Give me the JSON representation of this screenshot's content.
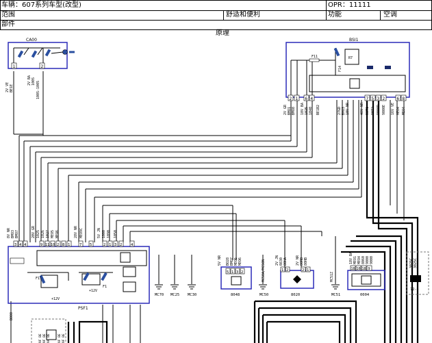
{
  "header": {
    "vehicle": "车辆：607系列车型(改型)",
    "opr": "OPR：11111",
    "scope_label": "范围",
    "scope_value": "舒适和便利",
    "function_label": "功能",
    "function_value": "空调",
    "parts_label": "部件"
  },
  "diagram": {
    "section_title": "原理",
    "components": {
      "ca00": {
        "label": "CA00",
        "pins": [
          "1",
          "2"
        ],
        "wires_1": [
          "2V VE",
          "BE1E"
        ],
        "wires_2": [
          "2V BA",
          "100S",
          "100S",
          "100S-1005"
        ]
      },
      "bsi1": {
        "label": "BSI1",
        "fuse_label": "F11",
        "relay_label": "R7",
        "fuse2_label": "F14",
        "pins_left": [
          "2",
          "1",
          "6",
          "4"
        ],
        "pins_right": [
          "7",
          "8",
          "5",
          "3",
          "2",
          "6",
          "8"
        ],
        "wires": [
          "2V GR",
          "BMO1",
          "BMO8",
          "10V BA",
          "1025",
          "1040",
          "BE1B2",
          "27GD",
          "BMO3",
          "10V NR",
          "40V NR",
          "90T1",
          "90T2",
          "9000D",
          "9000E",
          "16V VE",
          "MEO4",
          "MEO4"
        ]
      },
      "psf1": {
        "label": "PSF1",
        "pins": [
          "3",
          "4",
          "9",
          "11",
          "10",
          "2",
          "8",
          "1",
          "6",
          "7",
          "5",
          "2",
          "1",
          "3",
          "2",
          "4"
        ],
        "wires": [
          "8V NR",
          "BMO3",
          "BMO7",
          "20V GR",
          "1025",
          "1026",
          "1027",
          "MEO5",
          "MEO6",
          "28V NR",
          "MEO9C",
          "5V JN",
          "1000",
          "1090",
          "1050"
        ],
        "fuse_label": "F11",
        "relay_label": "F1",
        "supply_label": "+12V"
      },
      "ground_points": [
        "MC70",
        "MC25",
        "MC30"
      ],
      "b048": {
        "label": "8048",
        "pins": [
          "5",
          "1",
          "3",
          "2"
        ],
        "wires": [
          "5V NR",
          "BO28",
          "BMO7",
          "MEO5",
          "MEO6"
        ]
      },
      "mc50": {
        "label": "MC50",
        "wire": "MC50A/MC50N"
      },
      "b020": {
        "label": "8020",
        "pins": [
          "1",
          "2",
          "2",
          "1"
        ],
        "wires": [
          "2V JN",
          "0830",
          "80HA",
          "2V NR",
          "80RB",
          "80HB"
        ]
      },
      "mc51": {
        "label": "MC51",
        "wire": "MC51Z"
      },
      "c0004": {
        "label": "0004",
        "pins": [
          "18",
          "10",
          "18",
          "9"
        ],
        "wires": [
          "18V BA",
          "MEO1",
          "MEO4",
          "8060",
          "9000",
          "9000"
        ]
      },
      "connector_72": {
        "label": "72--",
        "wires": [
          "3025C",
          "3025C"
        ]
      },
      "bottom_wires": [
        "BO00",
        "9F BE",
        "9F BE",
        "9F BE",
        "9F BE",
        "9F BE"
      ]
    }
  },
  "colors": {
    "box_border": "#2a2ab8",
    "line": "#000000",
    "frame": "#000000"
  }
}
